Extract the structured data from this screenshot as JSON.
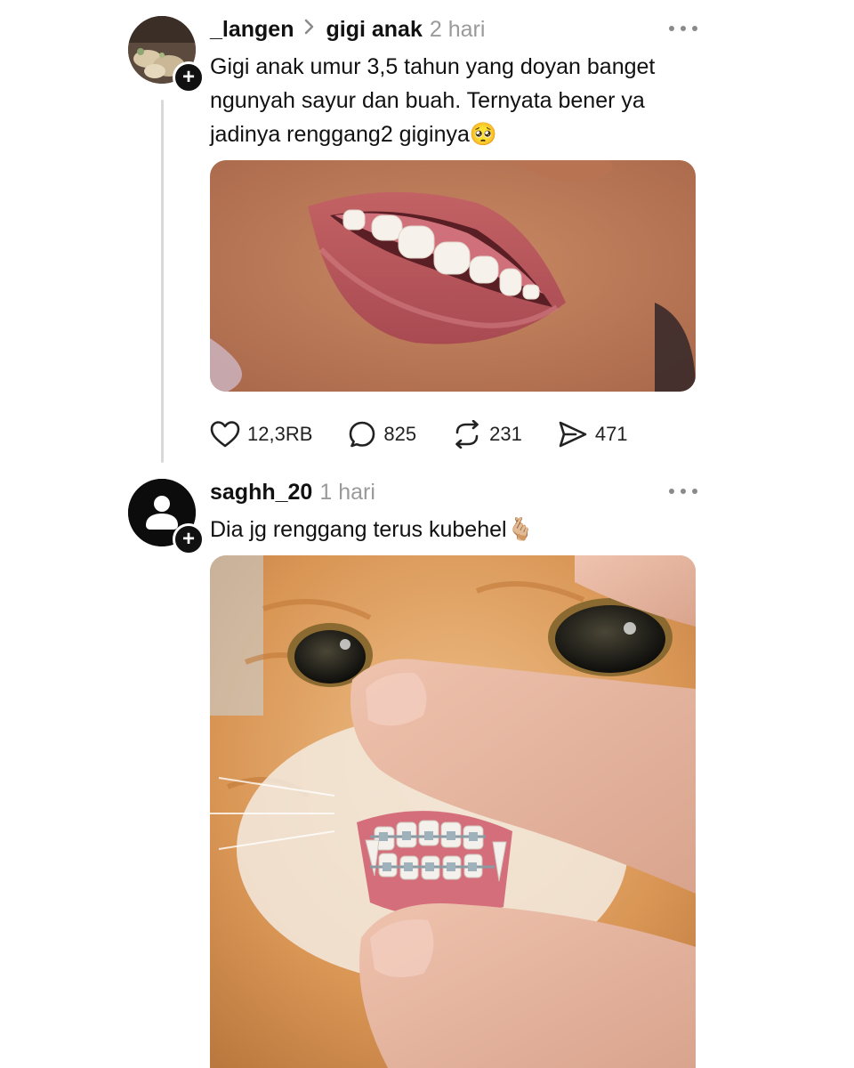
{
  "post1": {
    "username": "_langen",
    "topic": "gigi anak",
    "time": "2 hari",
    "text": "Gigi anak umur 3,5 tahun yang doyan banget ngunyah sayur dan buah. Ternyata bener ya jadinya renggang2 giginya🥺",
    "image_description": "close-up photo of a child's smiling mouth showing gapped teeth",
    "actions": {
      "likes": "12,3RB",
      "comments": "825",
      "reposts": "231",
      "shares": "471"
    }
  },
  "post2": {
    "username": "saghh_20",
    "time": "1 hari",
    "text": "Dia jg renggang terus kubehel🫰🏼",
    "image_description": "photo of an orange cat with braces on its teeth, lips held open by a finger"
  },
  "icons": [
    "chevron-right-icon",
    "more-icon",
    "heart-icon",
    "comment-icon",
    "repost-icon",
    "share-icon",
    "plus-icon",
    "person-icon"
  ]
}
